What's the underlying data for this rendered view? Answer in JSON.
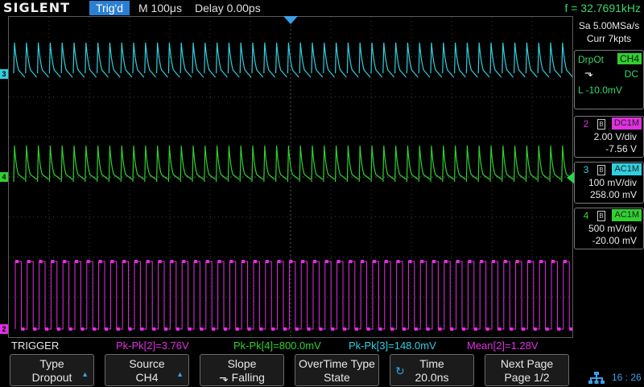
{
  "header": {
    "logo": "SIGLENT",
    "trigger_status": "Trig'd",
    "timebase": "M 100μs",
    "delay": "Delay 0.00ps",
    "frequency": "f = 32.7691kHz"
  },
  "acquisition": {
    "sample_rate": "Sa 5.00MSa/s",
    "memory": "Curr 7kpts"
  },
  "trigger_info": {
    "type": "DrpOt",
    "source": "CH4",
    "slope_icon": "falling-edge-icon",
    "coupling": "DC",
    "level": "L  -10.0mV"
  },
  "channels": [
    {
      "id": "2",
      "coupling": "DC1M",
      "scale": "2.00 V/div",
      "offset": "-7.56 V",
      "color": "#e030e0"
    },
    {
      "id": "3",
      "coupling": "AC1M",
      "scale": "100 mV/div",
      "offset": "258.00 mV",
      "color": "#30d0e0"
    },
    {
      "id": "4",
      "coupling": "AC1M",
      "scale": "500 mV/div",
      "offset": "-20.00 mV",
      "color": "#30d030"
    }
  ],
  "measurements": {
    "menu_title": "TRIGGER",
    "pkpk2": "Pk-Pk[2]=3.76V",
    "pkpk4": "Pk-Pk[4]=800.0mV",
    "pkpk3": "Pk-Pk[3]=148.0mV",
    "mean2": "Mean[2]=1.28V"
  },
  "softkeys": [
    {
      "line1": "Type",
      "line2": "Dropout"
    },
    {
      "line1": "Source",
      "line2": "CH4"
    },
    {
      "line1": "Slope",
      "line2": "⬎ Falling"
    },
    {
      "line1": "OverTime Type",
      "line2": "State"
    },
    {
      "line1": "Time",
      "line2": "20.0ns"
    },
    {
      "line1": "Next Page",
      "line2": "Page 1/2"
    }
  ],
  "system": {
    "time": "16 : 26"
  },
  "colors": {
    "ch3": "#30d0e0",
    "ch4": "#30d030",
    "ch2": "#e030e0",
    "accent": "#2a7fd4"
  }
}
